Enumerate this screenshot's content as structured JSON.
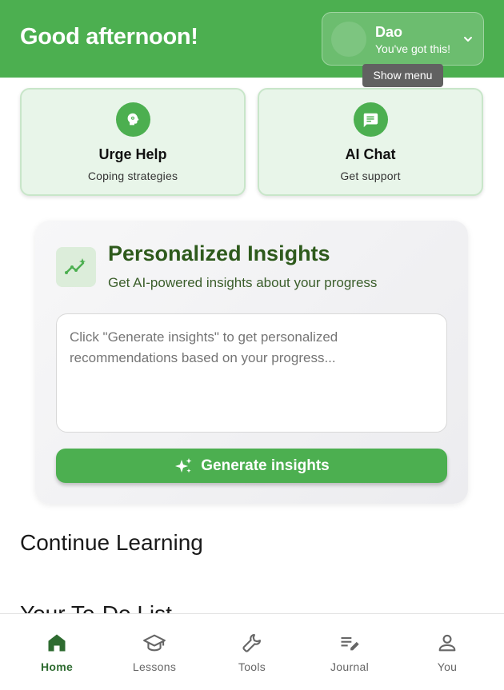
{
  "header": {
    "greeting": "Good afternoon!",
    "user": {
      "name": "Dao",
      "status": "You've got this!",
      "tooltip": "Show menu"
    }
  },
  "quick_actions": [
    {
      "title": "Urge Help",
      "subtitle": "Coping strategies",
      "icon": "brain-icon"
    },
    {
      "title": "AI Chat",
      "subtitle": "Get support",
      "icon": "chat-icon"
    }
  ],
  "insights": {
    "title": "Personalized Insights",
    "subtitle": "Get AI-powered insights about your progress",
    "placeholder": "Click \"Generate insights\" to get personalized recommendations based on your progress...",
    "button_label": "Generate insights",
    "icon": "trend-sparkle-icon"
  },
  "sections": {
    "continue_learning": "Continue Learning",
    "next_section_partial": "Your To-Do List"
  },
  "bottom_nav": {
    "active": "Home",
    "items": [
      {
        "label": "Home",
        "icon": "home-icon"
      },
      {
        "label": "Lessons",
        "icon": "graduation-cap-icon"
      },
      {
        "label": "Tools",
        "icon": "wrench-icon"
      },
      {
        "label": "Journal",
        "icon": "journal-edit-icon"
      },
      {
        "label": "You",
        "icon": "person-icon"
      }
    ]
  },
  "colors": {
    "primary": "#4caf50",
    "primary_dark": "#2e6b30",
    "card_bg": "#e8f5e9",
    "card_border": "#c8e6c9",
    "tooltip_bg": "#616161"
  }
}
